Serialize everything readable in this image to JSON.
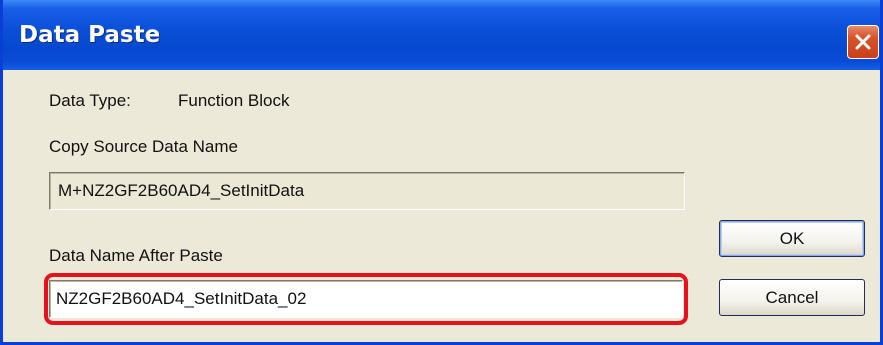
{
  "window": {
    "title": "Data Paste",
    "close_icon": "close-icon"
  },
  "data_type": {
    "label": "Data Type:",
    "value": "Function Block"
  },
  "copy_source": {
    "label": "Copy Source Data Name",
    "value": "M+NZ2GF2B60AD4_SetInitData"
  },
  "paste_name": {
    "label": "Data Name After Paste",
    "value": "NZ2GF2B60AD4_SetInitData_02"
  },
  "buttons": {
    "ok": "OK",
    "cancel": "Cancel"
  },
  "colors": {
    "titlebar": "#0a50d8",
    "dialog_bg": "#ece9d8",
    "highlight": "#e8101c",
    "close_button": "#d8552c"
  }
}
